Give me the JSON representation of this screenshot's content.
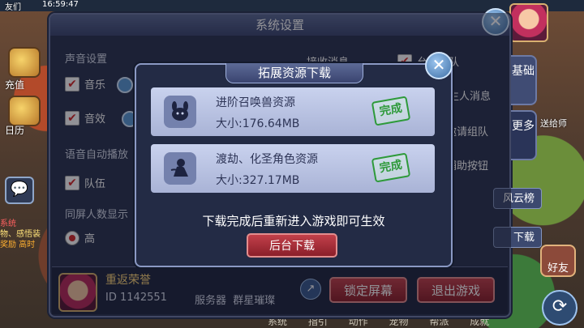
{
  "status": {
    "time": "16:59:47",
    "top_left": "友们"
  },
  "left_hud": {
    "recharge": "充值",
    "calendar": "日历",
    "chat_lines": [
      "系统",
      "物、感悟装",
      "奖励 高时"
    ]
  },
  "right_hud": {
    "friend": "好友",
    "gift": "送给师"
  },
  "bottom_tabs": [
    "系统",
    "指引",
    "动作",
    "宠物",
    "帮派",
    "成就"
  ],
  "settings": {
    "title": "系统设置",
    "sound_section": "声音设置",
    "music": "音乐",
    "sfx": "音效",
    "voice_section": "语音自动播放",
    "team": "队伍",
    "screen_section": "同屏人数显示",
    "high": "高",
    "right_options": [
      "接收消息",
      "允许组队",
      "陌生人消息",
      "邀请组队",
      "辅助按钮"
    ],
    "right_buttons": [
      "风云榜",
      "下载"
    ],
    "tabs": [
      "基础",
      "更多"
    ],
    "profile": {
      "name": "重返荣誉",
      "id_label": "ID",
      "id": "1142551",
      "server_label": "服务器",
      "server": "群星璀璨"
    },
    "lock_button": "锁定屏幕",
    "exit_button": "退出游戏"
  },
  "dialog": {
    "title": "拓展资源下载",
    "items": [
      {
        "name": "进阶召唤兽资源",
        "size": "大小:176.64MB",
        "status": "完成"
      },
      {
        "name": "渡劫、化圣角色资源",
        "size": "大小:327.17MB",
        "status": "完成"
      }
    ],
    "message": "下载完成后重新进入游戏即可生效",
    "button": "后台下载"
  },
  "icons": {
    "close": "close-icon",
    "share": "share-icon",
    "refresh": "refresh-icon",
    "pet_resource": "pet-resource-icon",
    "character_resource": "character-resource-icon"
  }
}
